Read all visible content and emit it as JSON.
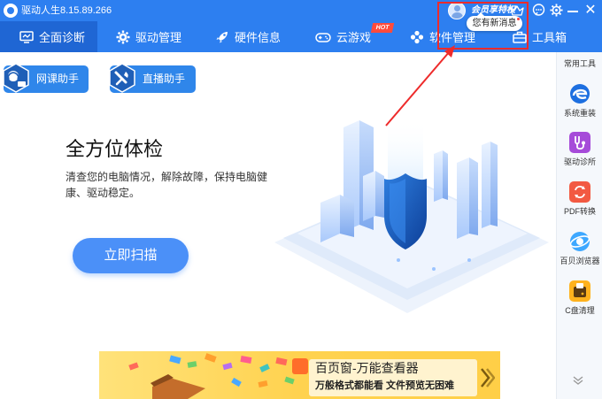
{
  "app": {
    "title": "驱动人生8.15.89.266"
  },
  "user": {
    "vip_label": "会员享特权",
    "message_bubble": "您有新消息"
  },
  "nav": {
    "tabs": [
      {
        "label": "全面诊断",
        "icon": "monitor-icon",
        "active": true
      },
      {
        "label": "驱动管理",
        "icon": "gear-icon",
        "active": false
      },
      {
        "label": "硬件信息",
        "icon": "rocket-icon",
        "active": false
      },
      {
        "label": "云游戏",
        "icon": "gamepad-icon",
        "active": false
      },
      {
        "label": "软件管理",
        "icon": "apps-icon",
        "active": false
      },
      {
        "label": "工具箱",
        "icon": "toolbox-icon",
        "active": false
      }
    ],
    "hot_badge": "HOT"
  },
  "helpers": [
    {
      "label": "网课助手"
    },
    {
      "label": "直播助手"
    }
  ],
  "hero": {
    "title": "全方位体检",
    "description": "清查您的电脑情况，解除故障，保持电脑健康、驱动稳定。",
    "scan_button": "立即扫描"
  },
  "sidebar": {
    "heading": "常用工具",
    "tools": [
      {
        "label": "系统重装",
        "icon": "edge-icon"
      },
      {
        "label": "驱动诊所",
        "icon": "stethoscope-icon"
      },
      {
        "label": "PDF转换",
        "icon": "pdf-convert-icon"
      },
      {
        "label": "百贝浏览器",
        "icon": "browser-icon"
      },
      {
        "label": "C盘清理",
        "icon": "disk-clean-icon"
      }
    ]
  },
  "banner": {
    "title": "百页窗-万能查看器",
    "subtitle": "万般格式都能看  文件预览无困难"
  },
  "colors": {
    "primary": "#2d7ff0",
    "nav_active": "#1f66d4",
    "button": "#4b90f8",
    "highlight": "#ee2b2b"
  }
}
